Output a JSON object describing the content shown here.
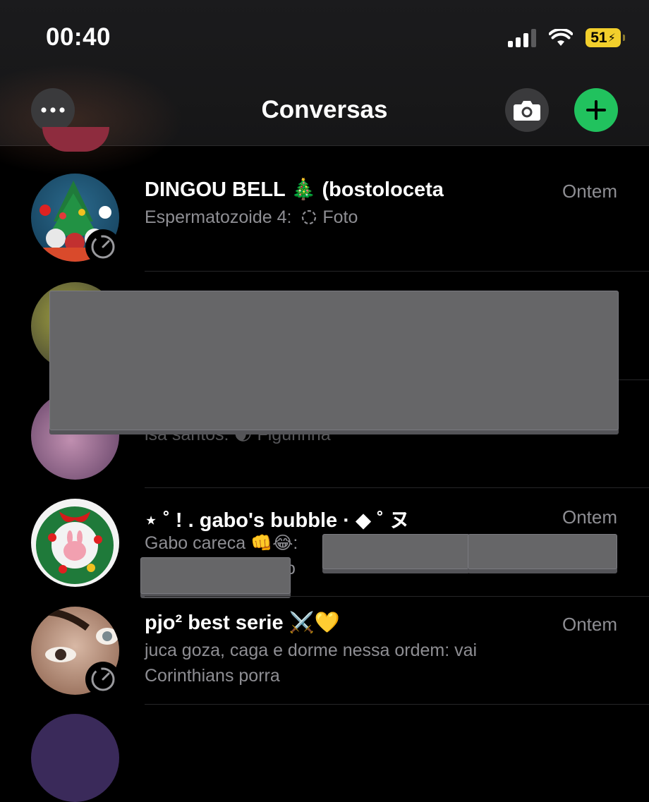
{
  "status_bar": {
    "time": "00:40",
    "battery": "51"
  },
  "header": {
    "title": "Conversas"
  },
  "conversations": [
    {
      "name": "DINGOU BELL 🎄 (bostoloceta",
      "time": "Ontem",
      "preview_author": "Espermatozoide 4:",
      "preview_text": "Foto"
    },
    {
      "name": "",
      "time": "",
      "preview_text": "isa santos: 🌒 Figurinha"
    },
    {
      "name": "⋆ ˚ ! . gabo's bubble · ◆ ˚ ヌ",
      "time": "Ontem",
      "preview_text": "Gabo careca 👊😂:",
      "preview_tail": "o"
    },
    {
      "name": "pjo² best serie ⚔️💛",
      "time": "Ontem",
      "preview_text": "juca goza, caga e dorme nessa ordem: vai Corinthians porra"
    }
  ],
  "colors": {
    "accent_green": "#21c25e",
    "battery_yellow": "#f2cf2c",
    "secondary_text": "#8e8e93"
  }
}
